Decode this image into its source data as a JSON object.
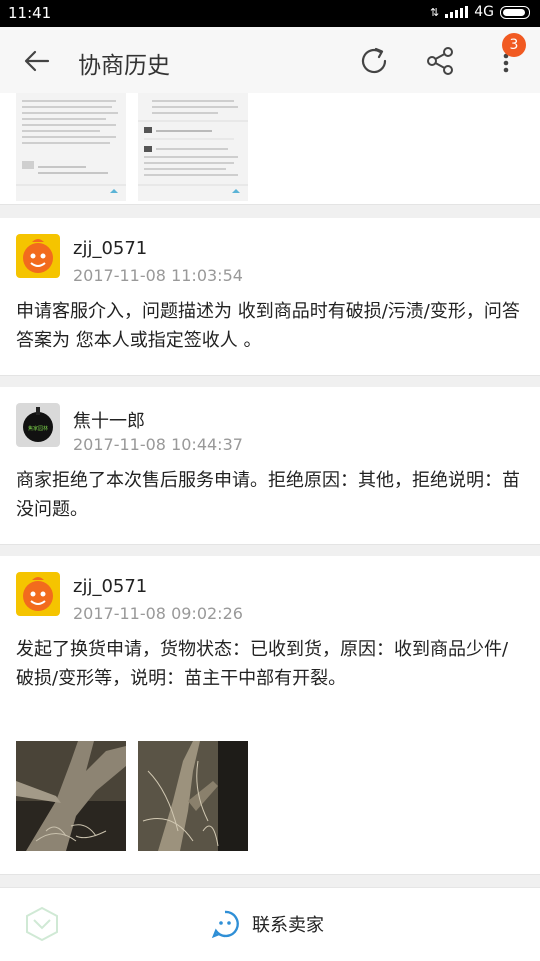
{
  "status_bar": {
    "time": "11:41",
    "network": "4G"
  },
  "header": {
    "title": "协商历史",
    "notification_count": "3"
  },
  "entries": [
    {
      "user": "zjj_0571",
      "timestamp": "2017-11-08 11:03:54",
      "message": "申请客服介入，问题描述为  收到商品时有破损/污渍/变形，问答答案为  您本人或指定签收人  。"
    },
    {
      "user": "焦十一郎",
      "timestamp": "2017-11-08 10:44:37",
      "message": "商家拒绝了本次售后服务申请。拒绝原因：其他，拒绝说明：苗没问题。"
    },
    {
      "user": "zjj_0571",
      "timestamp": "2017-11-08 09:02:26",
      "message": "发起了换货申请，货物状态：已收到货，原因：收到商品少件/破损/变形等，说明：苗主干中部有开裂。"
    }
  ],
  "footer": {
    "contact_label": "联系卖家"
  },
  "colors": {
    "accent": "#f15a22",
    "contact_icon": "#2f8fd6"
  }
}
